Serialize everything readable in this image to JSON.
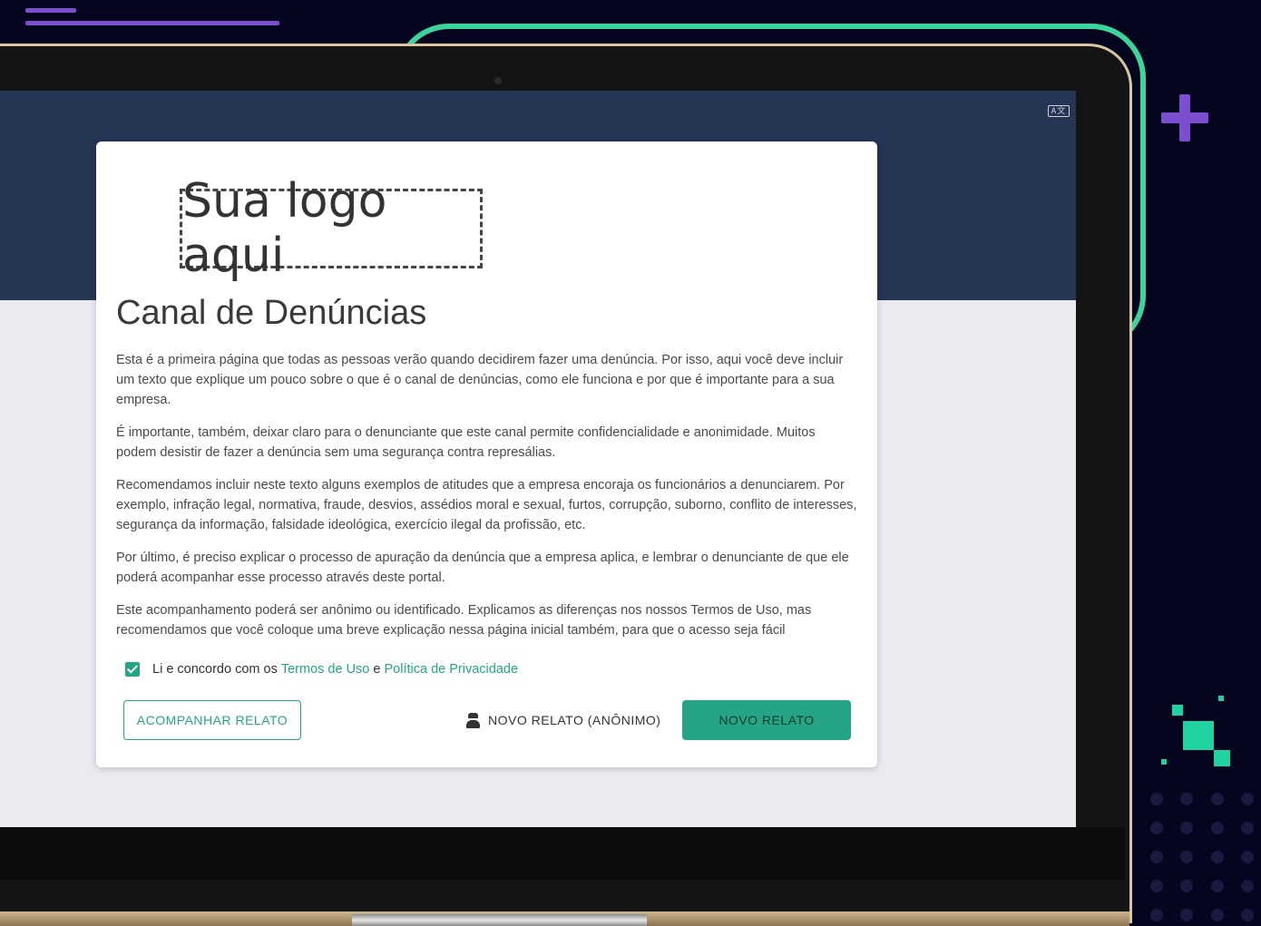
{
  "screen": {
    "translate_icon_label": "A文"
  },
  "card": {
    "logo_placeholder": "Sua logo aqui",
    "title": "Canal de Denúncias",
    "paragraphs": [
      "Esta é a primeira página que todas as pessoas verão quando decidirem fazer uma denúncia. Por isso, aqui você deve incluir um texto que explique um pouco sobre o que é o canal de denúncias, como ele funciona e por que é importante para a sua empresa.",
      "É importante, também, deixar claro para o denunciante que este canal permite confidencialidade e anonimidade. Muitos podem desistir de fazer a denúncia sem uma segurança contra represálias.",
      "Recomendamos incluir neste texto alguns exemplos de atitudes que a empresa encoraja os funcionários a denunciarem. Por exemplo, infração legal, normativa, fraude, desvios, assédios moral e sexual, furtos, corrupção, suborno, conflito de interesses, segurança da informação, falsidade ideológica, exercício ilegal da profissão, etc.",
      "Por último, é preciso explicar o processo de apuração da denúncia que a empresa aplica, e lembrar o denunciante de que ele poderá acompanhar esse processo através deste portal.",
      "Este acompanhamento poderá ser anônimo ou identificado. Explicamos as diferenças nos nossos Termos de Uso, mas recomendamos que você coloque uma breve explicação nessa página inicial também, para que o acesso seja fácil"
    ],
    "agreement": {
      "checked": true,
      "prefix": "Li e concordo com os",
      "terms_link": "Termos de Uso",
      "conjunction": "e",
      "privacy_link": "Política de Privacidade"
    },
    "buttons": {
      "follow_report": "ACOMPANHAR RELATO",
      "anonymous_report": "NOVO RELATO (ANÔNIMO)",
      "new_report": "NOVO RELATO"
    }
  },
  "icons": {
    "anonymous": "spy-icon",
    "translate": "translate-icon"
  },
  "colors": {
    "accent": "#26a586",
    "header": "#263554",
    "background": "#050520",
    "deco_green": "#3dd49c",
    "deco_purple": "#7c4fd0"
  }
}
